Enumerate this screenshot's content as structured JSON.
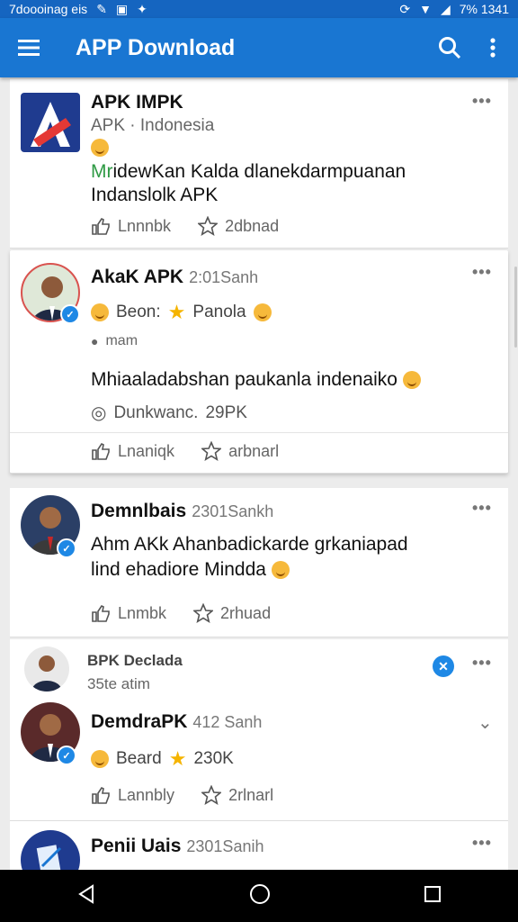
{
  "status_bar": {
    "left_text": "7doooinag eis",
    "right_text": "7% 1341"
  },
  "app_bar": {
    "title": "APP Download",
    "search_icon": "search-icon",
    "more_icon": "more-vert-icon"
  },
  "colors": {
    "primary": "#1976d2",
    "status": "#1565c0",
    "verified": "#1e88e5",
    "star": "#f5b400"
  },
  "posts": [
    {
      "name": "APK IMPK",
      "subtitle": "APK · Indonesia",
      "body_line1_prefix": "Mr",
      "body_line1": "idewKan Kalda dlanekdarmpuanan",
      "body_line2": "Indanslolk  APK",
      "like_label": "Lnnnbk",
      "share_label": "2dbnad"
    },
    {
      "name": "AkaK APK",
      "time": "2:01Sanh",
      "react_label": "Beon:",
      "react_value": "Panola",
      "location": "mam",
      "body_line1": "Mhiaaladabshan paukanla indenaiko",
      "meta_label": "Dunkwanc.",
      "meta_value": "29PK",
      "like_label": "Lnaniqk",
      "share_label": "arbnarl"
    },
    {
      "name": "Demnlbais",
      "time": "2301Sankh",
      "body_line1": "Ahm AKk Ahanbadickarde grkaniapad",
      "body_line2": "lind ehadiore Mindda",
      "like_label": "Lnmbk",
      "share_label": "2rhuad"
    },
    {
      "header_name": "BPK Declada",
      "header_sub": "35te atim",
      "name": "DemdraPK",
      "time": "412 Sanh",
      "react_label": "Beard",
      "react_value": "230K",
      "like_label": "Lannbly",
      "share_label": "2rlnarl"
    },
    {
      "name": "Penii Uais",
      "time": "2301Sanih"
    }
  ]
}
